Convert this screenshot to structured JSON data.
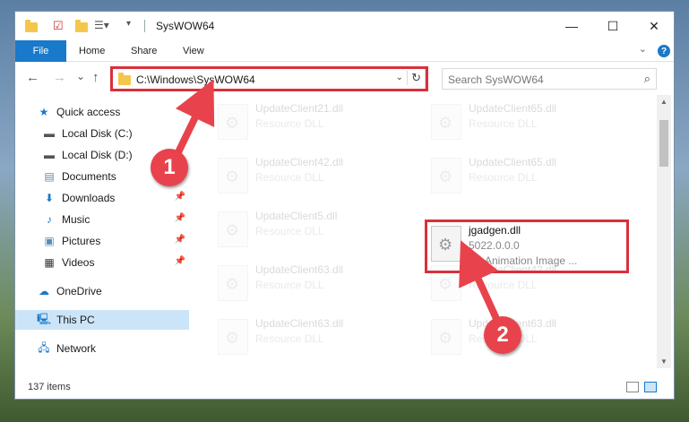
{
  "window": {
    "title": "SysWOW64",
    "controls": {
      "minimize": "—",
      "maximize": "☐",
      "close": "✕"
    }
  },
  "ribbon": {
    "tabs": [
      {
        "label": "File"
      },
      {
        "label": "Home"
      },
      {
        "label": "Share"
      },
      {
        "label": "View"
      }
    ],
    "help": "?"
  },
  "navigation": {
    "back": "←",
    "forward": "→",
    "recent": "⌄",
    "up": "↑",
    "address_path": "C:\\Windows\\SysWOW64",
    "search_placeholder": "Search SysWOW64"
  },
  "sidebar": {
    "items": [
      {
        "label": "Quick access",
        "icon": "star-icon",
        "pinned": false
      },
      {
        "label": "Local Disk (C:)",
        "icon": "drive-icon",
        "pinned": false
      },
      {
        "label": "Local Disk (D:)",
        "icon": "drive-icon",
        "pinned": false
      },
      {
        "label": "Documents",
        "icon": "documents-icon",
        "pinned": true
      },
      {
        "label": "Downloads",
        "icon": "downloads-icon",
        "pinned": true
      },
      {
        "label": "Music",
        "icon": "music-icon",
        "pinned": true
      },
      {
        "label": "Pictures",
        "icon": "pictures-icon",
        "pinned": true
      },
      {
        "label": "Videos",
        "icon": "videos-icon",
        "pinned": true
      },
      {
        "label": "OneDrive",
        "icon": "cloud-icon",
        "pinned": false
      },
      {
        "label": "This PC",
        "icon": "computer-icon",
        "pinned": false,
        "selected": true
      },
      {
        "label": "Network",
        "icon": "network-icon",
        "pinned": false
      }
    ]
  },
  "files": {
    "left_column": [
      {
        "name": "UpdateClient21.dll",
        "type": "Resource DLL"
      },
      {
        "name": "UpdateClient42.dll",
        "type": "Resource DLL"
      },
      {
        "name": "UpdateClient5.dll",
        "type": "Resource DLL"
      },
      {
        "name": "UpdateClient63.dll",
        "type": "Resource DLL"
      },
      {
        "name": "UpdateClient63.dll",
        "type": "Resource DLL"
      }
    ],
    "right_column": [
      {
        "name": "UpdateClient65.dll",
        "type": "Resource DLL"
      },
      {
        "name": "UpdateClient65.dll",
        "type": "Resource DLL"
      },
      {
        "name": "jgadgen.dll",
        "version": "5022.0.0.0",
        "type": "JG Animation Image ...",
        "highlighted": true
      },
      {
        "name": "UpdateClient42.dll",
        "type": "Resource DLL"
      },
      {
        "name": "UpdateClient63.dll",
        "type": "Resource DLL"
      }
    ]
  },
  "status": {
    "item_count": "137 items"
  },
  "annotations": {
    "badge1": "1",
    "badge2": "2",
    "color": "#e8434c"
  }
}
